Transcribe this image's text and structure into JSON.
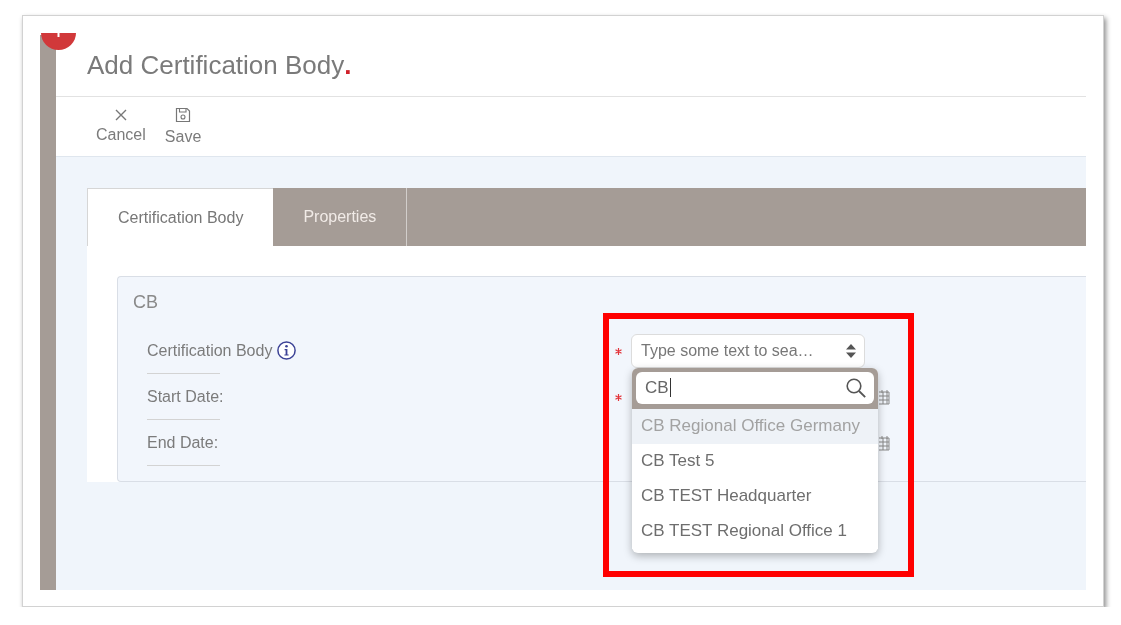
{
  "window": {
    "title": "Add Certification Body",
    "title_mark": "."
  },
  "toolbar": [
    {
      "kind": "cancel",
      "label": "Cancel"
    },
    {
      "kind": "save",
      "label": "Save"
    }
  ],
  "tabs": [
    {
      "label": "Certification Body",
      "selected": true
    },
    {
      "label": "Properties",
      "selected": false
    }
  ],
  "fieldset": {
    "legend": "CB",
    "fields": [
      {
        "kind": "select",
        "label": "Certification Body",
        "info": true,
        "required": true,
        "placeholder": "Type some text to sea…"
      },
      {
        "kind": "date",
        "label": "Start Date:",
        "info": false,
        "required": true
      },
      {
        "kind": "date",
        "label": "End Date:",
        "info": false,
        "required": false
      }
    ]
  },
  "dropdown": {
    "search": {
      "value": "CB"
    },
    "options": [
      {
        "label": "CB Regional Office Germany",
        "selected": true
      },
      {
        "label": "CB Test 5",
        "selected": false
      },
      {
        "label": "CB TEST Headquarter",
        "selected": false
      },
      {
        "label": "CB TEST Regional Office 1",
        "selected": false
      }
    ]
  }
}
